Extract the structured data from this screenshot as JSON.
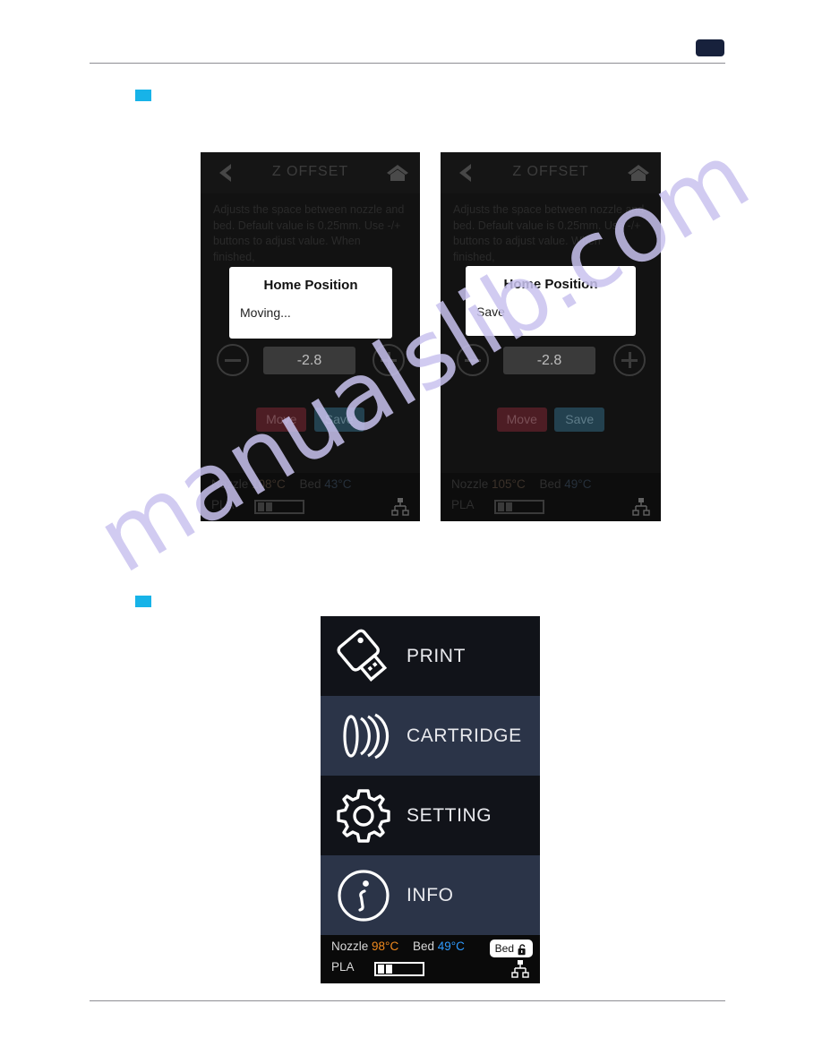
{
  "page": {
    "badge_label": "",
    "watermark": "manualslib.com"
  },
  "bullets": [
    {
      "name": "step-bullet-1"
    },
    {
      "name": "step-bullet-2"
    }
  ],
  "zoffset_screen_1": {
    "titlebar": {
      "back_icon": "chevron-left-icon",
      "title": "Z OFFSET",
      "home_icon": "home-icon"
    },
    "description": "Adjusts the space between nozzle and bed. Default value is 0.25mm. Use -/+ buttons to adjust value. When finished,",
    "dialog": {
      "title": "Home Position",
      "body": "Moving..."
    },
    "stepper": {
      "minus_label": "minus-icon",
      "value": "-2.8",
      "plus_label": "plus-icon"
    },
    "actions": {
      "move_label": "Move",
      "save_label": "Save"
    },
    "status": {
      "nozzle_label": "Nozzle",
      "nozzle_value": "108°C",
      "bed_label": "Bed",
      "bed_value": "43°C",
      "filament_label": "PLA"
    }
  },
  "zoffset_screen_2": {
    "titlebar": {
      "back_icon": "chevron-left-icon",
      "title": "Z OFFSET",
      "home_icon": "home-icon"
    },
    "description": "Adjusts the space between nozzle and bed. Default value is 0.25mm. Use -/+ buttons to adjust value. When finished,",
    "dialog": {
      "title": "Home Position",
      "body": "Save"
    },
    "stepper": {
      "minus_label": "minus-icon",
      "value": "-2.8",
      "plus_label": "plus-icon"
    },
    "actions": {
      "move_label": "Move",
      "save_label": "Save"
    },
    "status": {
      "nozzle_label": "Nozzle",
      "nozzle_value": "105°C",
      "bed_label": "Bed",
      "bed_value": "49°C",
      "filament_label": "PLA"
    }
  },
  "menu_screen": {
    "items": [
      {
        "label": "PRINT",
        "icon": "usb-drive-icon",
        "highlighted": false
      },
      {
        "label": "CARTRIDGE",
        "icon": "nfc-wave-icon",
        "highlighted": true
      },
      {
        "label": "SETTING",
        "icon": "gear-icon",
        "highlighted": false
      },
      {
        "label": "INFO",
        "icon": "info-circle-icon",
        "highlighted": true
      }
    ],
    "status": {
      "nozzle_label": "Nozzle",
      "nozzle_value": "98°C",
      "bed_label": "Bed",
      "bed_value": "49°C",
      "filament_label": "PLA",
      "bed_badge_label": "Bed",
      "bed_badge_icon": "unlocked-padlock-icon",
      "network_icon": "network-tree-icon"
    }
  },
  "colors": {
    "bullet": "#17b3e8",
    "nozzle_temp": "#f08a1e",
    "bed_temp": "#2f9bff",
    "menu_highlight": "#2b3448",
    "menu_dark": "#111319",
    "page_badge": "#17213c"
  }
}
